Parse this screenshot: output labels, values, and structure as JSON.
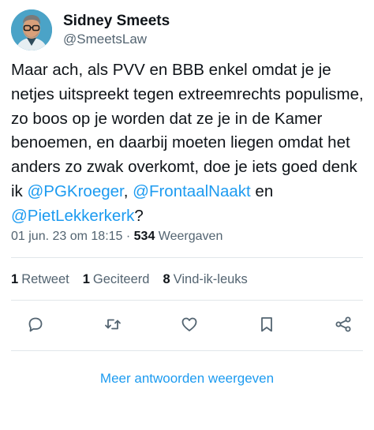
{
  "author": {
    "display_name": "Sidney Smeets",
    "handle": "@SmeetsLaw"
  },
  "tweet": {
    "segments": [
      {
        "text": "Maar ach, als PVV en BBB enkel omdat je je netjes uitspreekt tegen extreemrechts populisme, zo boos op je worden dat ze je in de Kamer benoemen, en daarbij moeten liegen omdat het anders zo zwak overkomt, doe je iets goed denk ik ",
        "mention": false
      },
      {
        "text": "@PGKroeger",
        "mention": true
      },
      {
        "text": ", ",
        "mention": false
      },
      {
        "text": "@FrontaalNaakt",
        "mention": true
      },
      {
        "text": " en ",
        "mention": false
      },
      {
        "text": "@PietLekkerkerk",
        "mention": true
      },
      {
        "text": "?",
        "mention": false
      }
    ]
  },
  "meta": {
    "timestamp": "01 jun. 23 om 18:15",
    "separator": " · ",
    "views_count": "534",
    "views_label": " Weergaven"
  },
  "stats": {
    "retweets_count": "1",
    "retweets_label": "Retweet",
    "quotes_count": "1",
    "quotes_label": "Geciteerd",
    "likes_count": "8",
    "likes_label": "Vind-ik-leuks"
  },
  "actions": [
    {
      "icon": "reply-icon"
    },
    {
      "icon": "retweet-icon"
    },
    {
      "icon": "like-icon"
    },
    {
      "icon": "bookmark-icon"
    },
    {
      "icon": "share-icon"
    }
  ],
  "more_replies_label": "Meer antwoorden weergeven",
  "colors": {
    "accent": "#1d9bf0",
    "text": "#0f1419",
    "secondary": "#536471",
    "divider": "#e1e6ea",
    "avatar_bg": "#4ba3c7"
  }
}
